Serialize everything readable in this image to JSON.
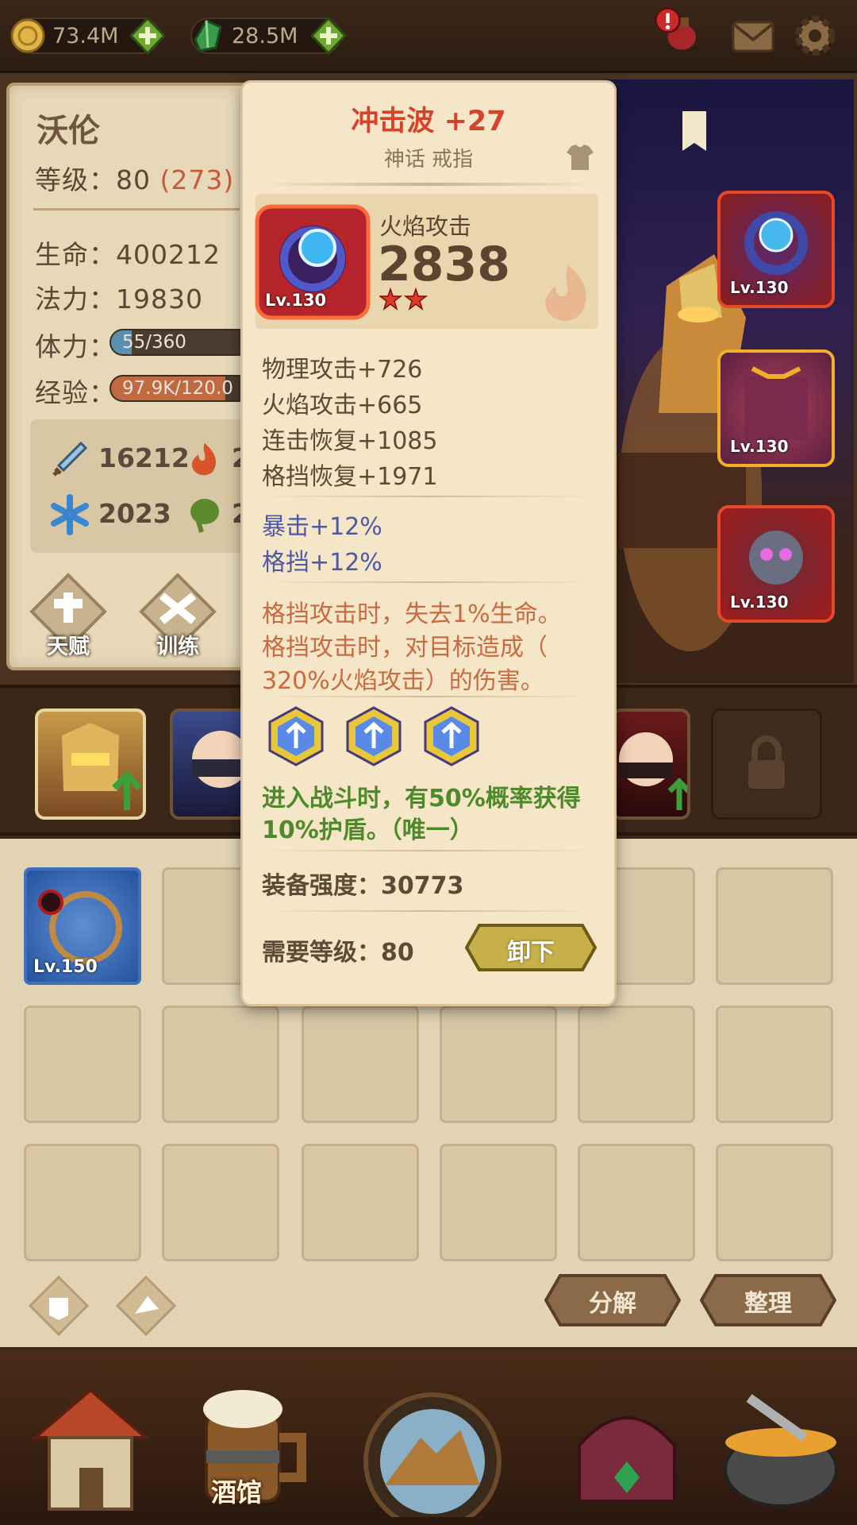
{
  "resources": {
    "gold": "73.4M",
    "gems": "28.5M"
  },
  "hero": {
    "name": "沃伦",
    "level_label": "等级：",
    "level": "80",
    "level_bonus": "(273)",
    "hp_label": "生命：",
    "hp": "400212",
    "mp_label": "法力：",
    "mp": "19830",
    "stamina_label": "体力：",
    "stamina": "55/360",
    "exp_label": "经验：",
    "exp": "97.9K/120.0",
    "powers": {
      "sword": "16212",
      "fire": "2",
      "ice": "2023",
      "poison": "2"
    }
  },
  "hero_buttons": {
    "talent": "天赋",
    "training": "训练"
  },
  "equipment_slots": [
    {
      "level": "Lv.130"
    },
    {
      "level": "Lv.130"
    },
    {
      "level": "Lv.130"
    }
  ],
  "inventory": {
    "ring_level": "Lv.150"
  },
  "inventory_buttons": {
    "decompose": "分解",
    "sort": "整理"
  },
  "bottom_nav": {
    "tavern": "酒馆"
  },
  "tooltip": {
    "name": "冲击波 +27",
    "type": "神话 戒指",
    "item_level": "Lv.130",
    "main_stat_label": "火焰攻击",
    "main_stat_value": "2838",
    "stars": 2,
    "stats": [
      "物理攻击+726",
      "火焰攻击+665",
      "连击恢复+1085",
      "格挡恢复+1971"
    ],
    "bonus_stats": [
      "暴击+12%",
      "格挡+12%"
    ],
    "effects": [
      "格挡攻击时，失去1%生命。",
      "格挡攻击时，对目标造成（",
      "320%火焰攻击）的伤害。"
    ],
    "gem_effect": [
      "进入战斗时，有50%概率获得",
      "10%护盾。（唯一）"
    ],
    "power_label": "装备强度：",
    "power_value": "30773",
    "req_label": "需要等级：",
    "req_value": "80",
    "unequip": "卸下"
  }
}
